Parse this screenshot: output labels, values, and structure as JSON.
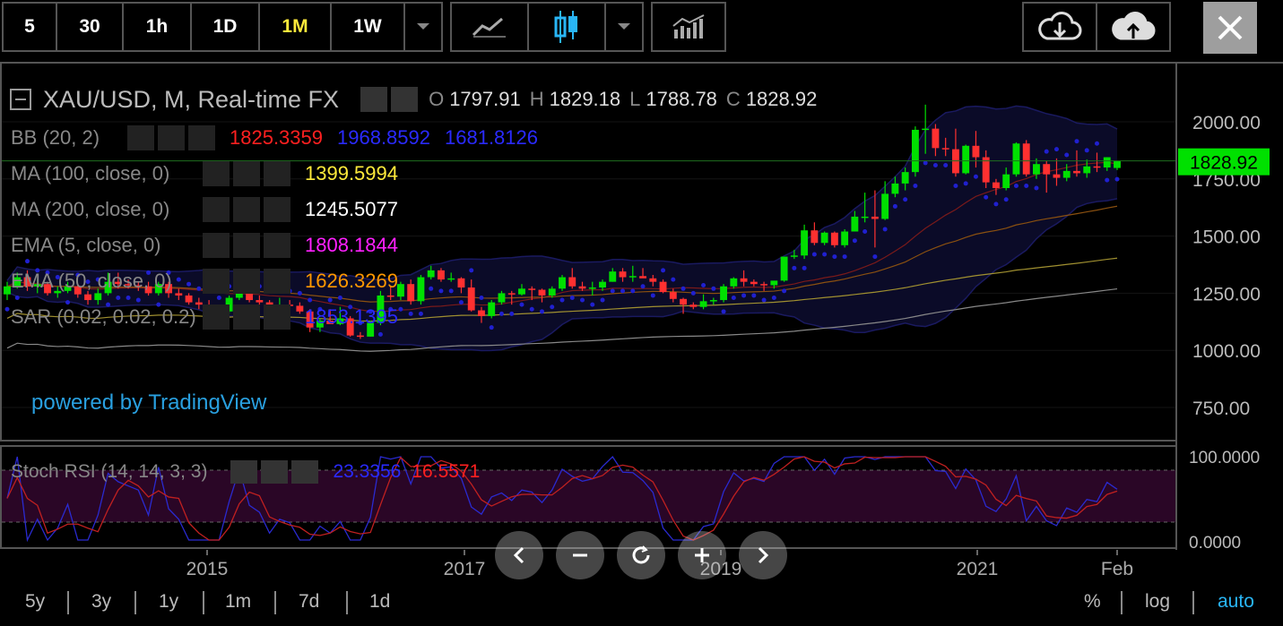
{
  "toolbar": {
    "intervals": [
      "5",
      "30",
      "1h",
      "1D",
      "1M",
      "1W"
    ],
    "active_interval": "1M"
  },
  "legend": {
    "title": "XAU/USD, M, Real-time FX",
    "ohlc": {
      "o_label": "O",
      "o": "1797.91",
      "h_label": "H",
      "h": "1829.18",
      "l_label": "L",
      "l": "1788.78",
      "c_label": "C",
      "c": "1828.92"
    }
  },
  "indicators": [
    {
      "label": "BB (20, 2)",
      "values": [
        "1825.3359",
        "1968.8592",
        "1681.8126"
      ],
      "colors": [
        "#ff2020",
        "#2a2aff",
        "#2a2aff"
      ]
    },
    {
      "label": "MA (100, close, 0)",
      "values": [
        "1399.5994"
      ],
      "colors": [
        "#ffeb3b"
      ]
    },
    {
      "label": "MA (200, close, 0)",
      "values": [
        "1245.5077"
      ],
      "colors": [
        "#ffffff"
      ]
    },
    {
      "label": "EMA (5, close, 0)",
      "values": [
        "1808.1844"
      ],
      "colors": [
        "#ff20ff"
      ]
    },
    {
      "label": "EMA (50, close, 0)",
      "values": [
        "1626.3269"
      ],
      "colors": [
        "#ff9800"
      ]
    },
    {
      "label": "SAR (0.02, 0.02, 0.2)",
      "values": [
        "1853.1395"
      ],
      "colors": [
        "#2a2aff"
      ]
    }
  ],
  "watermark": "powered by TradingView",
  "stoch": {
    "label": "Stoch RSI (14, 14, 3, 3)",
    "k": "23.3356",
    "d": "16.5571"
  },
  "price_axis": {
    "ticks": [
      "2000.00",
      "1750.00",
      "1500.00",
      "1250.00",
      "1000.00",
      "750.00"
    ],
    "current": "1828.92"
  },
  "stoch_axis": {
    "ticks": [
      "100.0000",
      "0.0000"
    ]
  },
  "time_axis": {
    "ticks": [
      "2015",
      "2017",
      "2019",
      "2021",
      "Feb"
    ]
  },
  "ranges": [
    "5y",
    "3y",
    "1y",
    "1m",
    "7d",
    "1d"
  ],
  "scale_opts": {
    "percent": "%",
    "log": "log",
    "auto": "auto"
  },
  "colors": {
    "up": "#00e000",
    "down": "#ff3030",
    "current_price_bg": "#00e000",
    "bb_fill": "#0b0b28"
  },
  "chart_data": {
    "type": "candlestick",
    "symbol": "XAU/USD",
    "interval": "M",
    "ylim": [
      650,
      2100
    ],
    "x_ticks": [
      "2015",
      "2017",
      "2019",
      "2021",
      "Feb"
    ],
    "candles": [
      [
        1245,
        1300,
        1220,
        1280
      ],
      [
        1280,
        1340,
        1270,
        1320
      ],
      [
        1320,
        1350,
        1260,
        1280
      ],
      [
        1280,
        1310,
        1250,
        1290
      ],
      [
        1290,
        1300,
        1240,
        1250
      ],
      [
        1250,
        1280,
        1230,
        1260
      ],
      [
        1260,
        1300,
        1250,
        1280
      ],
      [
        1280,
        1290,
        1230,
        1245
      ],
      [
        1245,
        1260,
        1200,
        1220
      ],
      [
        1220,
        1270,
        1200,
        1250
      ],
      [
        1250,
        1340,
        1240,
        1300
      ],
      [
        1300,
        1340,
        1270,
        1290
      ],
      [
        1290,
        1310,
        1270,
        1285
      ],
      [
        1285,
        1300,
        1260,
        1280
      ],
      [
        1280,
        1300,
        1240,
        1250
      ],
      [
        1250,
        1300,
        1240,
        1290
      ],
      [
        1290,
        1300,
        1230,
        1250
      ],
      [
        1250,
        1270,
        1220,
        1240
      ],
      [
        1240,
        1250,
        1200,
        1210
      ],
      [
        1210,
        1230,
        1180,
        1200
      ],
      [
        1200,
        1220,
        1150,
        1180
      ],
      [
        1180,
        1190,
        1130,
        1170
      ],
      [
        1170,
        1240,
        1160,
        1230
      ],
      [
        1230,
        1300,
        1220,
        1280
      ],
      [
        1280,
        1300,
        1210,
        1220
      ],
      [
        1220,
        1240,
        1190,
        1210
      ],
      [
        1210,
        1220,
        1160,
        1180
      ],
      [
        1180,
        1230,
        1170,
        1200
      ],
      [
        1200,
        1220,
        1170,
        1195
      ],
      [
        1195,
        1210,
        1160,
        1170
      ],
      [
        1170,
        1180,
        1080,
        1100
      ],
      [
        1100,
        1140,
        1080,
        1130
      ],
      [
        1130,
        1180,
        1120,
        1115
      ],
      [
        1115,
        1190,
        1110,
        1140
      ],
      [
        1140,
        1150,
        1060,
        1065
      ],
      [
        1065,
        1080,
        1050,
        1060
      ],
      [
        1060,
        1130,
        1060,
        1120
      ],
      [
        1120,
        1260,
        1110,
        1240
      ],
      [
        1240,
        1280,
        1220,
        1235
      ],
      [
        1235,
        1300,
        1220,
        1290
      ],
      [
        1290,
        1310,
        1200,
        1215
      ],
      [
        1215,
        1330,
        1200,
        1320
      ],
      [
        1320,
        1370,
        1310,
        1350
      ],
      [
        1350,
        1360,
        1300,
        1310
      ],
      [
        1310,
        1340,
        1300,
        1315
      ],
      [
        1315,
        1320,
        1250,
        1275
      ],
      [
        1275,
        1310,
        1170,
        1175
      ],
      [
        1175,
        1190,
        1120,
        1150
      ],
      [
        1150,
        1220,
        1140,
        1210
      ],
      [
        1210,
        1260,
        1200,
        1250
      ],
      [
        1250,
        1260,
        1200,
        1245
      ],
      [
        1245,
        1290,
        1240,
        1270
      ],
      [
        1270,
        1280,
        1220,
        1265
      ],
      [
        1265,
        1270,
        1210,
        1240
      ],
      [
        1240,
        1280,
        1230,
        1270
      ],
      [
        1270,
        1330,
        1260,
        1320
      ],
      [
        1320,
        1360,
        1270,
        1280
      ],
      [
        1280,
        1300,
        1260,
        1270
      ],
      [
        1270,
        1300,
        1240,
        1275
      ],
      [
        1275,
        1310,
        1260,
        1300
      ],
      [
        1300,
        1360,
        1300,
        1345
      ],
      [
        1345,
        1360,
        1300,
        1320
      ],
      [
        1320,
        1370,
        1300,
        1325
      ],
      [
        1325,
        1360,
        1320,
        1315
      ],
      [
        1315,
        1330,
        1280,
        1300
      ],
      [
        1300,
        1310,
        1250,
        1255
      ],
      [
        1255,
        1270,
        1210,
        1225
      ],
      [
        1225,
        1230,
        1160,
        1200
      ],
      [
        1200,
        1210,
        1180,
        1190
      ],
      [
        1190,
        1245,
        1180,
        1215
      ],
      [
        1215,
        1230,
        1200,
        1220
      ],
      [
        1220,
        1290,
        1210,
        1280
      ],
      [
        1280,
        1320,
        1270,
        1315
      ],
      [
        1315,
        1350,
        1280,
        1300
      ],
      [
        1300,
        1310,
        1280,
        1290
      ],
      [
        1290,
        1300,
        1260,
        1285
      ],
      [
        1285,
        1300,
        1270,
        1305
      ],
      [
        1305,
        1320,
        1300,
        1410
      ],
      [
        1410,
        1440,
        1400,
        1415
      ],
      [
        1415,
        1550,
        1400,
        1525
      ],
      [
        1525,
        1560,
        1460,
        1470
      ],
      [
        1470,
        1520,
        1460,
        1515
      ],
      [
        1515,
        1520,
        1450,
        1460
      ],
      [
        1460,
        1530,
        1450,
        1520
      ],
      [
        1520,
        1610,
        1520,
        1585
      ],
      [
        1585,
        1690,
        1560,
        1585
      ],
      [
        1585,
        1700,
        1450,
        1575
      ],
      [
        1575,
        1740,
        1570,
        1685
      ],
      [
        1685,
        1760,
        1670,
        1730
      ],
      [
        1730,
        1800,
        1700,
        1780
      ],
      [
        1780,
        1980,
        1760,
        1965
      ],
      [
        1965,
        2075,
        1860,
        1970
      ],
      [
        1970,
        1990,
        1850,
        1885
      ],
      [
        1885,
        1930,
        1850,
        1880
      ],
      [
        1880,
        1970,
        1760,
        1775
      ],
      [
        1775,
        1900,
        1770,
        1895
      ],
      [
        1895,
        1960,
        1800,
        1845
      ],
      [
        1845,
        1875,
        1710,
        1735
      ],
      [
        1735,
        1750,
        1680,
        1710
      ],
      [
        1710,
        1800,
        1700,
        1770
      ],
      [
        1770,
        1910,
        1760,
        1905
      ],
      [
        1905,
        1920,
        1760,
        1770
      ],
      [
        1770,
        1840,
        1750,
        1815
      ],
      [
        1815,
        1830,
        1690,
        1770
      ],
      [
        1770,
        1840,
        1720,
        1755
      ],
      [
        1755,
        1815,
        1740,
        1785
      ],
      [
        1785,
        1875,
        1760,
        1775
      ],
      [
        1775,
        1835,
        1755,
        1805
      ],
      [
        1805,
        1865,
        1780,
        1800
      ],
      [
        1800,
        1845,
        1785,
        1845
      ],
      [
        1797.91,
        1829.18,
        1788.78,
        1828.92
      ]
    ]
  }
}
